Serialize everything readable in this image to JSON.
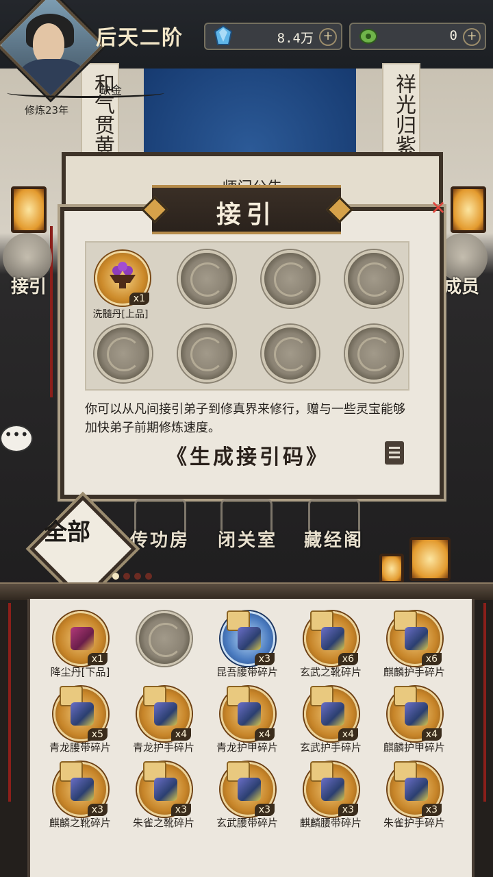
{
  "header": {
    "rank": "后天二阶",
    "resources": [
      {
        "icon": "spirit-crystal-icon",
        "value": "8.4万"
      },
      {
        "icon": "jade-icon",
        "value": "0"
      }
    ],
    "player_name": "缺金",
    "cultivation_years": "修炼23年"
  },
  "scene": {
    "couplet_left": "和气贯黄",
    "couplet_right": "祥光归紫",
    "board_title": "师门公告",
    "left_nav_label": "接引",
    "right_nav_label": "成员"
  },
  "popup": {
    "title": "接引",
    "items": [
      {
        "name": "洗髓丹[上品]",
        "count": "x1",
        "icon": "elixir-bowl-icon"
      }
    ],
    "empty_slots": 7,
    "description": "你可以从凡间接引弟子到修真界来修行，赠与一些灵宝能够加快弟子前期修炼速度。",
    "action": "《生成接引码》"
  },
  "buildings": {
    "all_badge": "全部",
    "items": [
      {
        "label": "传功房",
        "icon": "hall-icon"
      },
      {
        "label": "闭关室",
        "icon": "meditation-room-icon"
      },
      {
        "label": "藏经阁",
        "icon": "library-icon"
      }
    ],
    "page_dots": 4,
    "active_dot": 0
  },
  "inventory": [
    {
      "name": "降尘丹[下品]",
      "count": "x1",
      "style": "bronze",
      "icon": "pill-box-icon"
    },
    {
      "name": "",
      "count": "",
      "style": "grey",
      "icon": "empty-slot-icon"
    },
    {
      "name": "昆吾腰带碎片",
      "count": "x3",
      "style": "blue",
      "icon": "belt-fragment-icon"
    },
    {
      "name": "玄武之靴碎片",
      "count": "x6",
      "style": "bronze",
      "icon": "boots-fragment-icon"
    },
    {
      "name": "麒麟护手碎片",
      "count": "x6",
      "style": "bronze",
      "icon": "gauntlet-fragment-icon"
    },
    {
      "name": "青龙腰带碎片",
      "count": "x5",
      "style": "bronze",
      "icon": "belt-fragment-icon"
    },
    {
      "name": "青龙护手碎片",
      "count": "x4",
      "style": "bronze",
      "icon": "gauntlet-fragment-icon"
    },
    {
      "name": "青龙护甲碎片",
      "count": "x4",
      "style": "bronze",
      "icon": "armor-fragment-icon"
    },
    {
      "name": "玄武护手碎片",
      "count": "x4",
      "style": "bronze",
      "icon": "gauntlet-fragment-icon"
    },
    {
      "name": "麒麟护甲碎片",
      "count": "x4",
      "style": "bronze",
      "icon": "armor-fragment-icon"
    },
    {
      "name": "麒麟之靴碎片",
      "count": "x3",
      "style": "bronze",
      "icon": "boots-fragment-icon"
    },
    {
      "name": "朱雀之靴碎片",
      "count": "x3",
      "style": "bronze",
      "icon": "boots-fragment-icon"
    },
    {
      "name": "玄武腰带碎片",
      "count": "x3",
      "style": "bronze",
      "icon": "belt-fragment-icon"
    },
    {
      "name": "麒麟腰带碎片",
      "count": "x3",
      "style": "bronze",
      "icon": "belt-fragment-icon"
    },
    {
      "name": "朱雀护手碎片",
      "count": "x3",
      "style": "bronze",
      "icon": "gauntlet-fragment-icon"
    }
  ],
  "colors": {
    "accent_gold": "#d6a24a",
    "close_red": "#e0473e",
    "paper": "#ece7dd"
  }
}
